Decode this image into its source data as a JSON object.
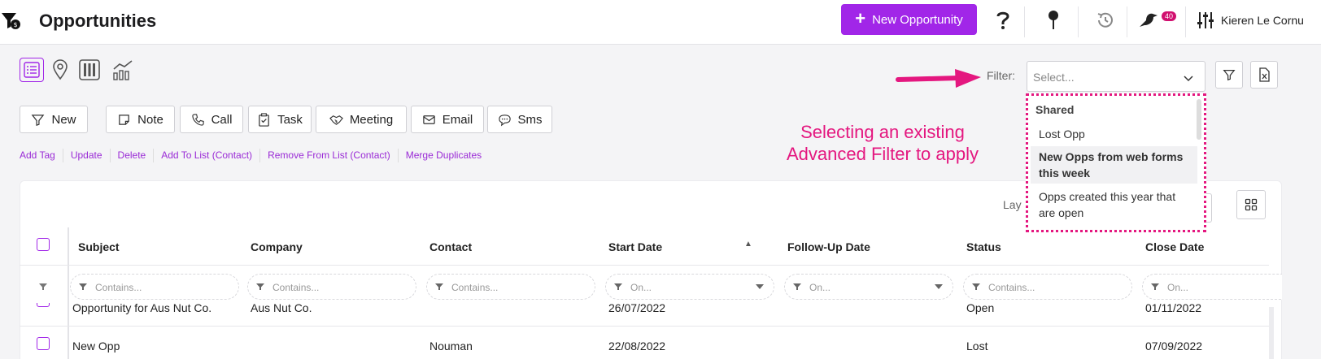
{
  "header": {
    "title": "Opportunities",
    "new_button_label": "New Opportunity",
    "notification_count": "40",
    "user_name": "Kieren Le Cornu"
  },
  "views": [
    "list-view-icon",
    "map-view-icon",
    "kanban-view-icon",
    "chart-view-icon"
  ],
  "actions": {
    "new": "New",
    "note": "Note",
    "call": "Call",
    "task": "Task",
    "meeting": "Meeting",
    "email": "Email",
    "sms": "Sms"
  },
  "links": [
    "Add Tag",
    "Update",
    "Delete",
    "Add To List (Contact)",
    "Remove From List (Contact)",
    "Merge Duplicates"
  ],
  "filter": {
    "label": "Filter:",
    "placeholder": "Select...",
    "dropdown": {
      "group": "Shared",
      "items": [
        "Lost Opp",
        "New Opps from web forms this week",
        "Opps created this year that are open"
      ]
    }
  },
  "annotation": "Selecting an existing Advanced Filter to apply",
  "grid": {
    "layout_label": "Lay",
    "columns": [
      "Subject",
      "Company",
      "Contact",
      "Start Date",
      "Follow-Up Date",
      "Status",
      "Close Date"
    ],
    "filter_placeholders": [
      "Contains...",
      "Contains...",
      "Contains...",
      "On...",
      "On...",
      "Contains...",
      "On..."
    ],
    "rows": [
      {
        "subject": "Opportunity for Aus Nut Co.",
        "company": "Aus Nut Co.",
        "contact": "",
        "start_date": "26/07/2022",
        "followup": "",
        "status": "Open",
        "close_date": "01/11/2022"
      },
      {
        "subject": "New Opp",
        "company": "",
        "contact": "Nouman",
        "start_date": "22/08/2022",
        "followup": "",
        "status": "Lost",
        "close_date": "07/09/2022"
      }
    ]
  },
  "colors": {
    "accent": "#a126e8",
    "annotation": "#e4177f",
    "badge": "#d1106f"
  }
}
